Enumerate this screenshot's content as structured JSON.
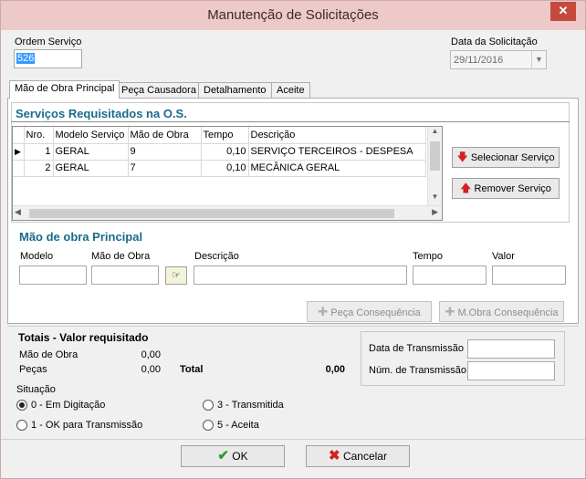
{
  "window": {
    "title": "Manutenção de Solicitações",
    "close_glyph": "✕"
  },
  "header": {
    "ordem_label": "Ordem Serviço",
    "ordem_value": "526",
    "data_label": "Data da Solicitação",
    "data_value": "29/11/2016"
  },
  "tabs": [
    {
      "label": "Mão de Obra Principal",
      "active": true
    },
    {
      "label": "Peça Causadora",
      "active": false
    },
    {
      "label": "Detalhamento",
      "active": false
    },
    {
      "label": "Aceite",
      "active": false
    }
  ],
  "servicos": {
    "title": "Serviços Requisitados na O.S.",
    "columns": [
      "Nro.",
      "Modelo Serviço",
      "Mão de Obra",
      "Tempo",
      "Descrição"
    ],
    "rows": [
      {
        "nro": "1",
        "modelo": "GERAL",
        "mao": "9",
        "tempo": "0,10",
        "descricao": "SERVIÇO TERCEIROS - DESPESA"
      },
      {
        "nro": "2",
        "modelo": "GERAL",
        "mao": "7",
        "tempo": "0,10",
        "descricao": "MECÂNICA GERAL"
      }
    ],
    "selecionar_label": "Selecionar Serviço",
    "remover_label": "Remover Serviço"
  },
  "mao_obra": {
    "title": "Mão de obra Principal",
    "modelo_label": "Modelo",
    "mao_label": "Mão de Obra",
    "descricao_label": "Descrição",
    "tempo_label": "Tempo",
    "valor_label": "Valor",
    "peca_consequencia_label": "Peça Consequência",
    "mobra_consequencia_label": "M.Obra Consequência"
  },
  "totais": {
    "title": "Totais - Valor requisitado",
    "mao_label": "Mão de Obra",
    "mao_value": "0,00",
    "pecas_label": "Peças",
    "pecas_value": "0,00",
    "total_label": "Total",
    "total_value": "0,00",
    "data_transmissao_label": "Data de Transmissão",
    "num_transmissao_label": "Núm. de Transmissão"
  },
  "situacao": {
    "label": "Situação",
    "options": [
      {
        "label": "0 - Em Digitação",
        "checked": true
      },
      {
        "label": "1 - OK para Transmissão",
        "checked": false
      },
      {
        "label": "3 - Transmitida",
        "checked": false
      },
      {
        "label": "5 - Aceita",
        "checked": false
      }
    ]
  },
  "footer": {
    "ok_label": "OK",
    "cancelar_label": "Cancelar"
  },
  "colors": {
    "accent_title": "#1a6b8a",
    "titlebar": "#eec9c9",
    "close": "#c44a3e"
  }
}
